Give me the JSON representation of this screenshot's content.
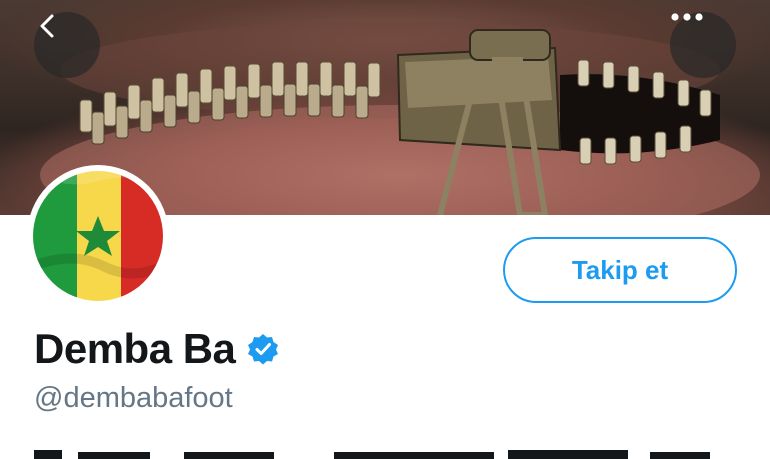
{
  "header": {
    "back_icon": "chevron-left-icon",
    "more_icon": "more-horizontal-icon",
    "banner_subject": "zipper-mouth-image"
  },
  "profile": {
    "avatar_icon": "senegal-flag-avatar",
    "follow_label": "Takip et",
    "display_name": "Demba Ba",
    "handle": "@dembabafoot",
    "verified_icon": "verified-badge-icon"
  },
  "colors": {
    "accent": "#1d9bf0",
    "text_primary": "#14171a",
    "text_secondary": "#657786"
  }
}
